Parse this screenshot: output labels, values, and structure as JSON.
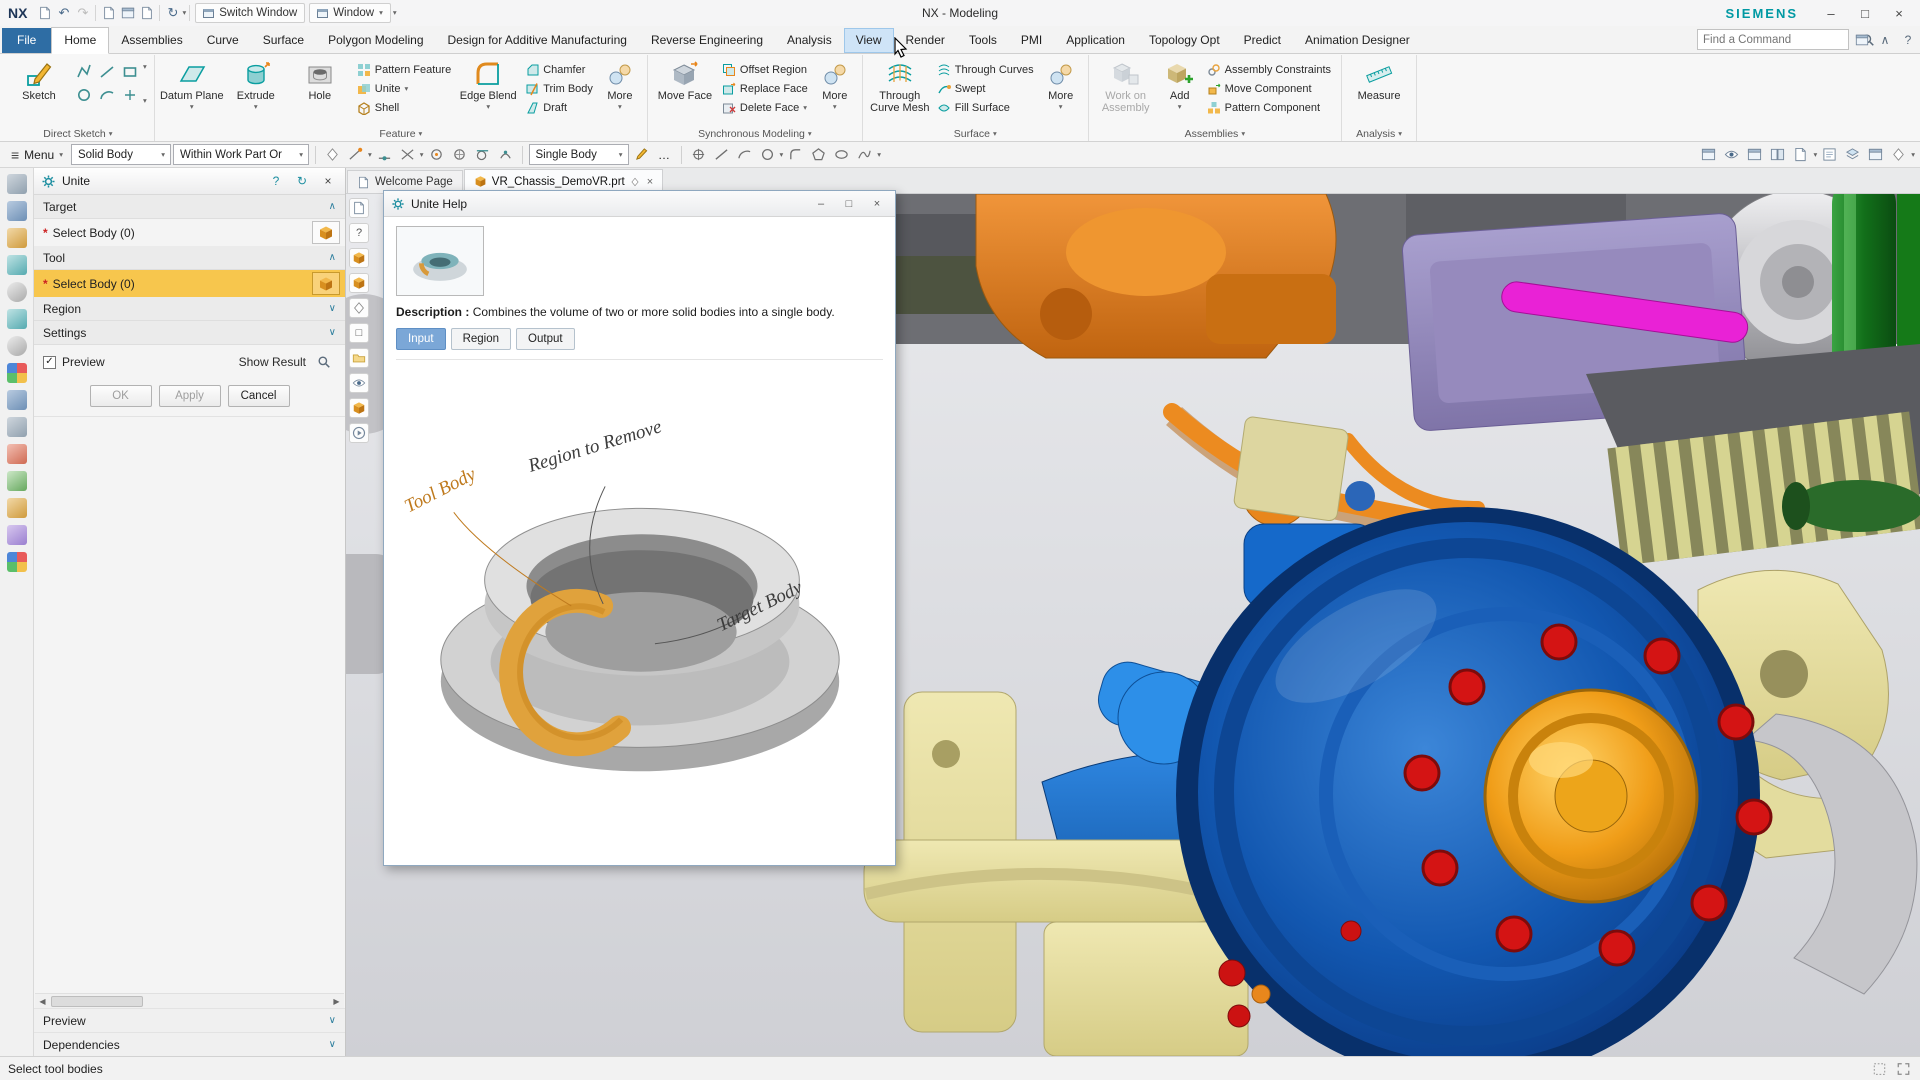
{
  "window": {
    "app": "NX",
    "switch_window": "Switch Window",
    "window_menu": "Window",
    "title": "NX - Modeling",
    "brand": "SIEMENS"
  },
  "ribbon_tabs": [
    "File",
    "Home",
    "Assemblies",
    "Curve",
    "Surface",
    "Polygon Modeling",
    "Design for Additive Manufacturing",
    "Reverse Engineering",
    "Analysis",
    "View",
    "Render",
    "Tools",
    "PMI",
    "Application",
    "Topology Opt",
    "Predict",
    "Animation Designer"
  ],
  "search": {
    "placeholder": "Find a Command"
  },
  "ribbon": {
    "direct_sketch": {
      "label": "Direct Sketch",
      "sketch": "Sketch"
    },
    "feature": {
      "label": "Feature",
      "datum_plane": "Datum Plane",
      "extrude": "Extrude",
      "hole": "Hole",
      "pattern_feature": "Pattern Feature",
      "unite": "Unite",
      "shell": "Shell",
      "edge_blend": "Edge Blend",
      "chamfer": "Chamfer",
      "trim_body": "Trim Body",
      "draft": "Draft",
      "more": "More"
    },
    "synchronous": {
      "label": "Synchronous Modeling",
      "move_face": "Move Face",
      "offset_region": "Offset Region",
      "replace_face": "Replace Face",
      "delete_face": "Delete Face",
      "more": "More"
    },
    "surface": {
      "label": "Surface",
      "through_curve_mesh": "Through Curve Mesh",
      "through_curves": "Through Curves",
      "swept": "Swept",
      "fill_surface": "Fill Surface",
      "more": "More"
    },
    "assemblies": {
      "label": "Assemblies",
      "work_on_assembly": "Work on Assembly",
      "add": "Add",
      "assembly_constraints": "Assembly Constraints",
      "move_component": "Move Component",
      "pattern_component": "Pattern Component"
    },
    "analysis": {
      "label": "Analysis",
      "measure": "Measure"
    }
  },
  "toolbar": {
    "menu": "Menu",
    "selection_filter": "Solid Body",
    "selection_scope": "Within Work Part Or",
    "curve_rule": "Single Body"
  },
  "document_tabs": {
    "welcome": "Welcome Page",
    "part": "VR_Chassis_DemoVR.prt"
  },
  "unite_panel": {
    "title": "Unite",
    "required_marker": "*",
    "target_header": "Target",
    "target_select": "Select Body (0)",
    "tool_header": "Tool",
    "tool_select": "Select Body (0)",
    "region_header": "Region",
    "settings_header": "Settings",
    "preview_label": "Preview",
    "show_result_label": "Show Result",
    "ok": "OK",
    "apply": "Apply",
    "cancel": "Cancel",
    "preview_section": "Preview",
    "dependencies_section": "Dependencies"
  },
  "help_dialog": {
    "title": "Unite Help",
    "description_label": "Description :",
    "description": "Combines the volume of two or more solid bodies into a single body.",
    "input_btn": "Input",
    "region_btn": "Region",
    "output_btn": "Output",
    "tool_body": "Tool Body",
    "region_to_remove": "Region to Remove",
    "target_body": "Target Body"
  },
  "status": {
    "message": "Select tool bodies"
  },
  "icons": {
    "chevron_down": "▾",
    "section_open": "∧",
    "section_closed": "∨",
    "close": "×",
    "help": "?",
    "refresh": "↻",
    "minimize": "–",
    "maximize": "□",
    "check": "✓",
    "menu": "≡",
    "ellipsis": "…",
    "scroll_left": "◀",
    "scroll_right": "▶",
    "undo": "↶",
    "redo": "↷"
  },
  "colors": {
    "selection_highlight": "#f7c64d",
    "siemens_teal": "#0099a3",
    "nx_accent": "#0a9ea0",
    "file_tab_blue": "#2e6da4"
  }
}
